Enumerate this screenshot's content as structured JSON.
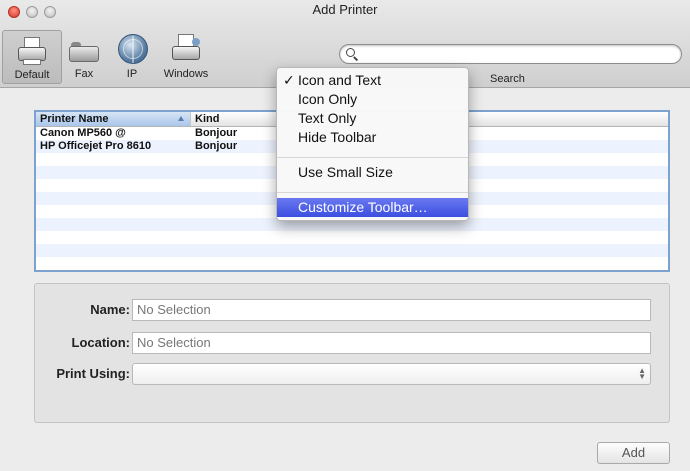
{
  "window": {
    "title": "Add Printer"
  },
  "toolbar": {
    "items": [
      {
        "label": "Default",
        "icon": "printer-icon"
      },
      {
        "label": "Fax",
        "icon": "fax-icon"
      },
      {
        "label": "IP",
        "icon": "globe-icon"
      },
      {
        "label": "Windows",
        "icon": "windows-printer-icon"
      }
    ],
    "search_label": "Search",
    "search_value": ""
  },
  "list": {
    "columns": [
      "Printer Name",
      "Kind"
    ],
    "rows": [
      {
        "name": "Canon MP560 @",
        "kind": "Bonjour"
      },
      {
        "name": "HP Officejet Pro 8610",
        "kind": "Bonjour"
      }
    ]
  },
  "details": {
    "name_label": "Name:",
    "name_value": "No Selection",
    "location_label": "Location:",
    "location_value": "No Selection",
    "print_using_label": "Print Using:",
    "print_using_value": ""
  },
  "buttons": {
    "add": "Add"
  },
  "context_menu": {
    "items": [
      {
        "label": "Icon and Text",
        "checked": true
      },
      {
        "label": "Icon Only"
      },
      {
        "label": "Text Only"
      },
      {
        "label": "Hide Toolbar"
      },
      {
        "label": "Use Small Size"
      },
      {
        "label": "Customize Toolbar…",
        "highlighted": true
      }
    ],
    "check_glyph": "✓"
  },
  "colors": {
    "selection_blue": "#3b4fe0",
    "list_focus": "#7da2ce",
    "close_red": "#d9382a"
  }
}
